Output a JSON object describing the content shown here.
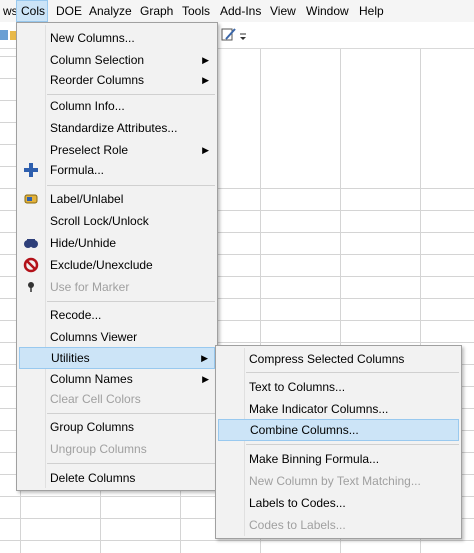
{
  "menubar": {
    "items": [
      "ws",
      "Cols",
      "DOE",
      "Analyze",
      "Graph",
      "Tools",
      "Add-Ins",
      "View",
      "Window",
      "Help"
    ],
    "active": "Cols"
  },
  "cols_menu": {
    "items": [
      {
        "label": "New Columns...",
        "submenu": false,
        "disabled": false
      },
      {
        "label": "Column Selection",
        "submenu": true,
        "disabled": false
      },
      {
        "label": "Reorder Columns",
        "submenu": true,
        "disabled": false
      },
      {
        "label": "Column Info...",
        "submenu": false,
        "disabled": false
      },
      {
        "label": "Standardize Attributes...",
        "submenu": false,
        "disabled": false
      },
      {
        "label": "Preselect Role",
        "submenu": true,
        "disabled": false
      },
      {
        "label": "Formula...",
        "submenu": false,
        "disabled": false,
        "icon": "plus-icon"
      },
      {
        "label": "Label/Unlabel",
        "submenu": false,
        "disabled": false,
        "icon": "label-icon"
      },
      {
        "label": "Scroll Lock/Unlock",
        "submenu": false,
        "disabled": false
      },
      {
        "label": "Hide/Unhide",
        "submenu": false,
        "disabled": false,
        "icon": "hide-icon"
      },
      {
        "label": "Exclude/Unexclude",
        "submenu": false,
        "disabled": false,
        "icon": "exclude-icon"
      },
      {
        "label": "Use for Marker",
        "submenu": false,
        "disabled": true,
        "icon": "marker-icon"
      },
      {
        "label": "Recode...",
        "submenu": false,
        "disabled": false
      },
      {
        "label": "Columns Viewer",
        "submenu": false,
        "disabled": false
      },
      {
        "label": "Utilities",
        "submenu": true,
        "disabled": false,
        "highlighted": true
      },
      {
        "label": "Column Names",
        "submenu": true,
        "disabled": false
      },
      {
        "label": "Clear Cell Colors",
        "submenu": false,
        "disabled": true
      },
      {
        "label": "Group Columns",
        "submenu": false,
        "disabled": false
      },
      {
        "label": "Ungroup Columns",
        "submenu": false,
        "disabled": true
      },
      {
        "label": "Delete Columns",
        "submenu": false,
        "disabled": false
      }
    ]
  },
  "utilities_menu": {
    "items": [
      {
        "label": "Compress Selected Columns",
        "disabled": false
      },
      {
        "label": "Text to Columns...",
        "disabled": false
      },
      {
        "label": "Make Indicator Columns...",
        "disabled": false
      },
      {
        "label": "Combine Columns...",
        "disabled": false,
        "highlighted": true
      },
      {
        "label": "Make Binning Formula...",
        "disabled": false
      },
      {
        "label": "New Column by Text Matching...",
        "disabled": true
      },
      {
        "label": "Labels to Codes...",
        "disabled": false
      },
      {
        "label": "Codes to Labels...",
        "disabled": true
      }
    ]
  },
  "colors": {
    "highlight_bg": "#cce4f7",
    "highlight_border": "#99c9ef",
    "menu_bg": "#f2f2f2",
    "disabled_text": "#a0a0a0"
  }
}
